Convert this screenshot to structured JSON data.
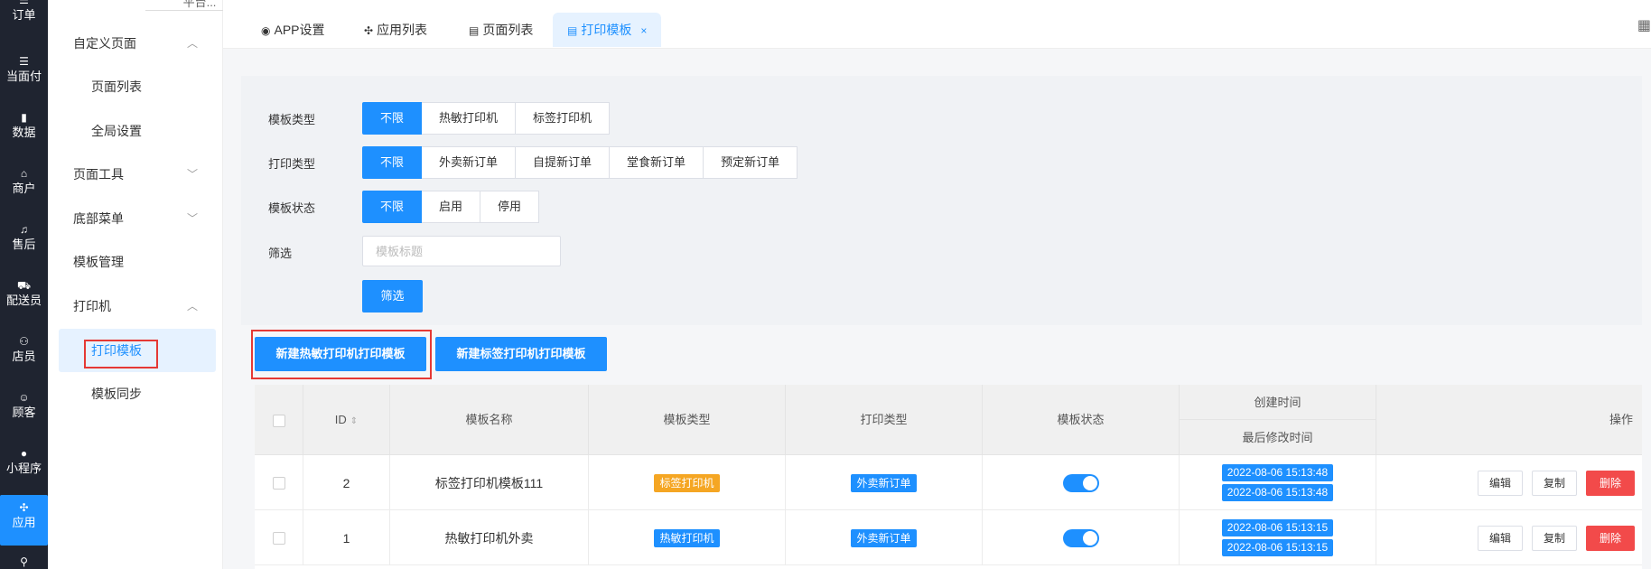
{
  "rail": {
    "items": [
      {
        "icon": "☰",
        "label": "订单"
      },
      {
        "icon": "☰",
        "label": "当面付"
      },
      {
        "icon": "▮",
        "label": "数据"
      },
      {
        "icon": "⌂",
        "label": "商户"
      },
      {
        "icon": "♫",
        "label": "售后"
      },
      {
        "icon": "⛟",
        "label": "配送员"
      },
      {
        "icon": "⚇",
        "label": "店员"
      },
      {
        "icon": "☺",
        "label": "顾客"
      },
      {
        "icon": "●",
        "label": "小程序"
      },
      {
        "icon": "✣",
        "label": "应用"
      },
      {
        "icon": "⚲",
        "label": ""
      }
    ]
  },
  "menu": {
    "top_cut": "平台...",
    "custom_page": "自定义页面",
    "page_list": "页面列表",
    "global_settings": "全局设置",
    "page_tools": "页面工具",
    "bottom_menu": "底部菜单",
    "template_manage": "模板管理",
    "printer": "打印机",
    "print_template": "打印模板",
    "template_sync": "模板同步"
  },
  "tabs": [
    {
      "icon": "◉",
      "label": "APP设置"
    },
    {
      "icon": "✣",
      "label": "应用列表"
    },
    {
      "icon": "▤",
      "label": "页面列表"
    },
    {
      "icon": "▤",
      "label": "打印模板",
      "close": "×"
    }
  ],
  "filter": {
    "template_type": {
      "label": "模板类型",
      "options": [
        "不限",
        "热敏打印机",
        "标签打印机"
      ]
    },
    "print_type": {
      "label": "打印类型",
      "options": [
        "不限",
        "外卖新订单",
        "自提新订单",
        "堂食新订单",
        "预定新订单"
      ]
    },
    "template_status": {
      "label": "模板状态",
      "options": [
        "不限",
        "启用",
        "停用"
      ]
    },
    "search": {
      "label": "筛选",
      "placeholder": "模板标题",
      "value": ""
    },
    "submit": "筛选"
  },
  "actions": {
    "new_thermal": "新建热敏打印机打印模板",
    "new_label": "新建标签打印机打印模板"
  },
  "table": {
    "headers": {
      "id": "ID",
      "name": "模板名称",
      "template_type": "模板类型",
      "print_type": "打印类型",
      "status": "模板状态",
      "created": "创建时间",
      "modified": "最后修改时间",
      "ops": "操作"
    },
    "rows": [
      {
        "id": "2",
        "name": "标签打印机模板111",
        "template_type": "标签打印机",
        "print_type": "外卖新订单",
        "created": "2022-08-06 15:13:48",
        "modified": "2022-08-06 15:13:48"
      },
      {
        "id": "1",
        "name": "热敏打印机外卖",
        "template_type": "热敏打印机",
        "print_type": "外卖新订单",
        "created": "2022-08-06 15:13:15",
        "modified": "2022-08-06 15:13:15"
      }
    ],
    "op_labels": {
      "edit": "编辑",
      "copy": "复制",
      "delete": "删除"
    }
  }
}
